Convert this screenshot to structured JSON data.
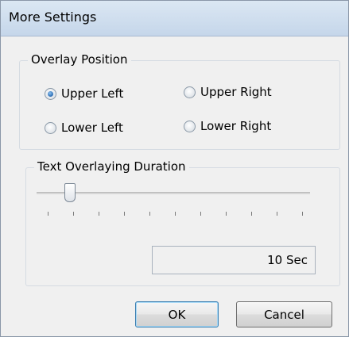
{
  "dialog": {
    "title": "More Settings"
  },
  "overlay_position": {
    "legend": "Overlay Position",
    "options": [
      {
        "label": "Upper Left",
        "checked": true
      },
      {
        "label": "Upper Right",
        "checked": false
      },
      {
        "label": "Lower Left",
        "checked": false
      },
      {
        "label": "Lower Right",
        "checked": false
      }
    ]
  },
  "duration": {
    "legend": "Text Overlaying Duration",
    "value_text": "10 Sec",
    "slider_level_fraction": 0.1,
    "tick_count": 11
  },
  "buttons": {
    "ok_label": "OK",
    "cancel_label": "Cancel"
  }
}
